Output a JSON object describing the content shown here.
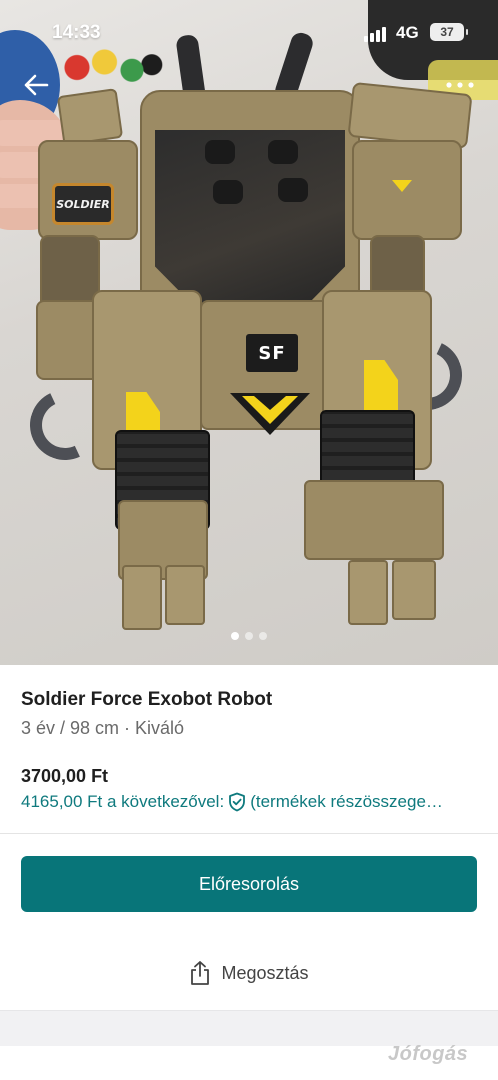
{
  "status_bar": {
    "time": "14:33",
    "network": "4G",
    "battery": "37"
  },
  "photo": {
    "badge_left": "SOLDIER",
    "badge_chest": "SF",
    "carousel": {
      "count": 3,
      "active_index": 0
    }
  },
  "listing": {
    "title": "Soldier Force Exobot Robot",
    "subtitle": "3 év / 98 cm · Kiváló",
    "price": "3700,00 Ft",
    "buyer_price": "4165,00 Ft a következővel:",
    "buyer_price_note": "(termékek részösszege…"
  },
  "actions": {
    "promote_label": "Előresorolás",
    "share_label": "Megosztás"
  },
  "watermark": "Jófogás",
  "colors": {
    "accent": "#087579",
    "link": "#0f7a7e"
  },
  "icons": {
    "back": "back-arrow-icon",
    "more": "more-dots-icon",
    "shield": "shield-check-icon",
    "share": "share-icon"
  }
}
